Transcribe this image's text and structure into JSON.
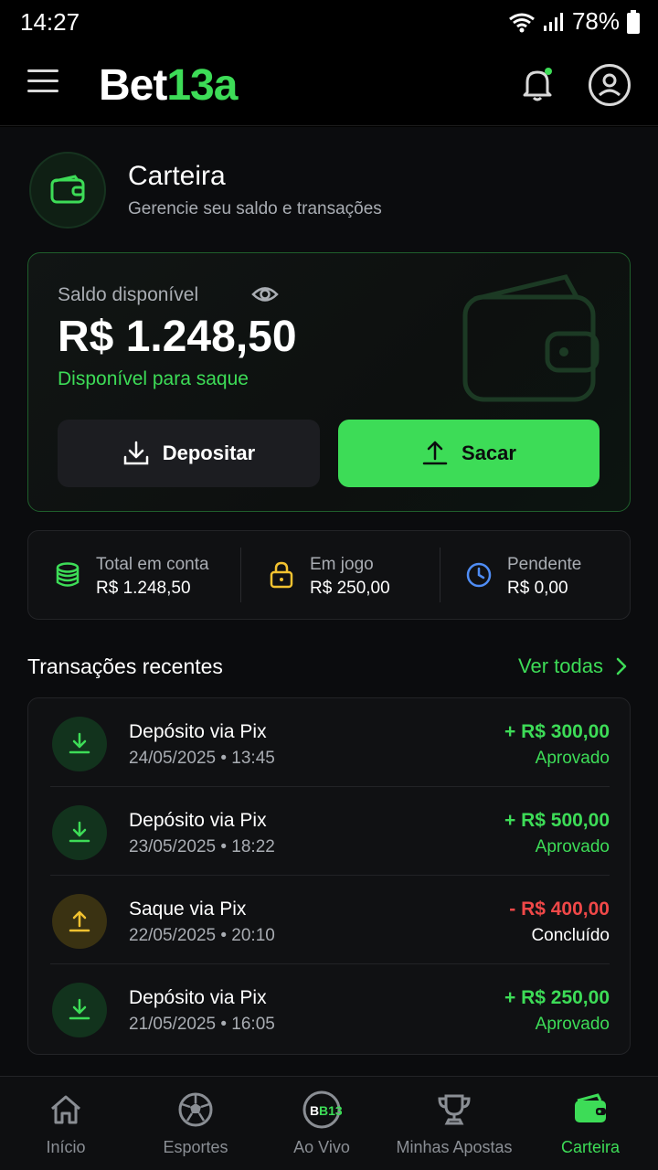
{
  "status_bar": {
    "time": "14:27",
    "battery": "78%"
  },
  "header": {
    "logo_part1": "Bet",
    "logo_part2": "13a"
  },
  "page": {
    "title": "Carteira",
    "subtitle": "Gerencie seu saldo e transações"
  },
  "balance": {
    "label": "Saldo disponível",
    "amount": "R$ 1.248,50",
    "note": "Disponível para saque",
    "deposit_label": "Depositar",
    "withdraw_label": "Sacar"
  },
  "stats": [
    {
      "label": "Total em conta",
      "value": "R$ 1.248,50",
      "icon": "coins-icon",
      "color": "#3ddc57"
    },
    {
      "label": "Em jogo",
      "value": "R$ 250,00",
      "icon": "lock-icon",
      "color": "#f2c230"
    },
    {
      "label": "Pendente",
      "value": "R$ 0,00",
      "icon": "clock-icon",
      "color": "#4f8df5"
    }
  ],
  "transactions_section": {
    "title": "Transações recentes",
    "see_all": "Ver todas"
  },
  "transactions": [
    {
      "title": "Depósito via Pix",
      "date": "24/05/2025 • 13:45",
      "amount": "+ R$ 300,00",
      "status": "Aprovado",
      "type": "deposit"
    },
    {
      "title": "Depósito via Pix",
      "date": "23/05/2025 • 18:22",
      "amount": "+ R$ 500,00",
      "status": "Aprovado",
      "type": "deposit"
    },
    {
      "title": "Saque via Pix",
      "date": "22/05/2025 • 20:10",
      "amount": "- R$ 400,00",
      "status": "Concluído",
      "type": "withdraw"
    },
    {
      "title": "Depósito via Pix",
      "date": "21/05/2025 • 16:05",
      "amount": "+ R$ 250,00",
      "status": "Aprovado",
      "type": "deposit"
    }
  ],
  "bottom_nav": [
    {
      "label": "Início",
      "icon": "home-icon"
    },
    {
      "label": "Esportes",
      "icon": "soccer-ball-icon"
    },
    {
      "label": "Ao Vivo",
      "icon": "live-b13-icon",
      "badge": "B13"
    },
    {
      "label": "Minhas Apostas",
      "icon": "trophy-icon"
    },
    {
      "label": "Carteira",
      "icon": "wallet-icon",
      "active": true
    }
  ],
  "colors": {
    "accent": "#3ddc57",
    "negative": "#f04848",
    "background": "#0b0c0e",
    "card": "#101113"
  }
}
